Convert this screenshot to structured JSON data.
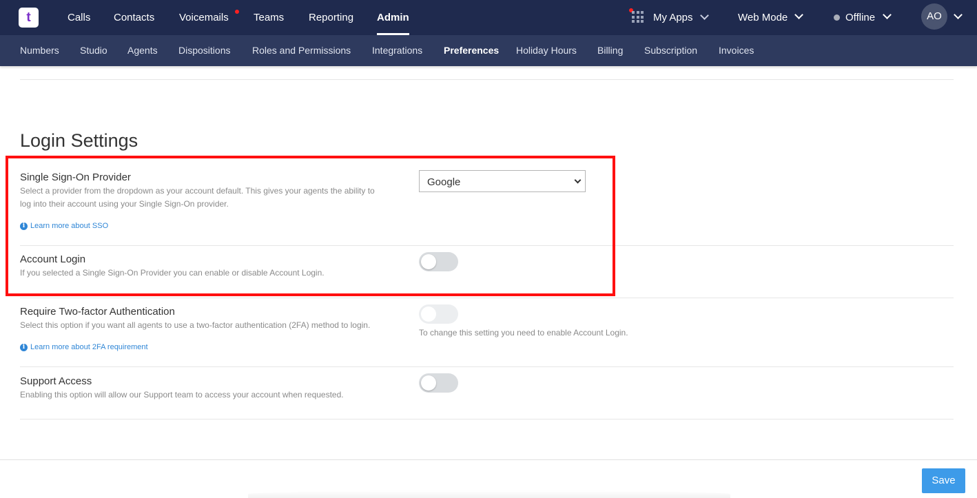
{
  "topnav": {
    "logo_text": "t",
    "items": [
      "Calls",
      "Contacts",
      "Voicemails",
      "Teams",
      "Reporting",
      "Admin"
    ],
    "active": "Admin",
    "my_apps": "My Apps",
    "web_mode": "Web Mode",
    "status": "Offline",
    "avatar_initials": "AO"
  },
  "subnav": {
    "items": [
      "Numbers",
      "Studio",
      "Agents",
      "Dispositions",
      "Roles and Permissions",
      "Integrations",
      "Preferences",
      "Holiday Hours",
      "Billing",
      "Subscription",
      "Invoices"
    ],
    "active": "Preferences"
  },
  "login_settings": {
    "title": "Login Settings",
    "sso": {
      "title": "Single Sign-On Provider",
      "desc_line1": "Select a provider from the dropdown as your account default. This gives your agents the ability to",
      "desc_line2": "log into their account using your Single Sign-On provider.",
      "learn_more": "Learn more about SSO",
      "selected": "Google"
    },
    "account_login": {
      "title": "Account Login",
      "desc": "If you selected a Single Sign-On Provider you can enable or disable Account Login.",
      "enabled": false
    },
    "two_factor": {
      "title": "Require Two-factor Authentication",
      "desc": "Select this option if you want all agents to use a two-factor authentication (2FA) method to login.",
      "learn_more": "Learn more about 2FA requirement",
      "note": "To change this setting you need to enable Account Login.",
      "enabled": false
    },
    "support_access": {
      "title": "Support Access",
      "desc": "Enabling this option will allow our Support team to access your account when requested.",
      "enabled": false
    }
  },
  "footer": {
    "save_label": "Save"
  },
  "colors": {
    "topbar": "#1f2a4e",
    "subnav": "#2e3a5e",
    "accent": "#3d9be9",
    "link": "#2f86d6",
    "highlight": "#ff1010"
  }
}
